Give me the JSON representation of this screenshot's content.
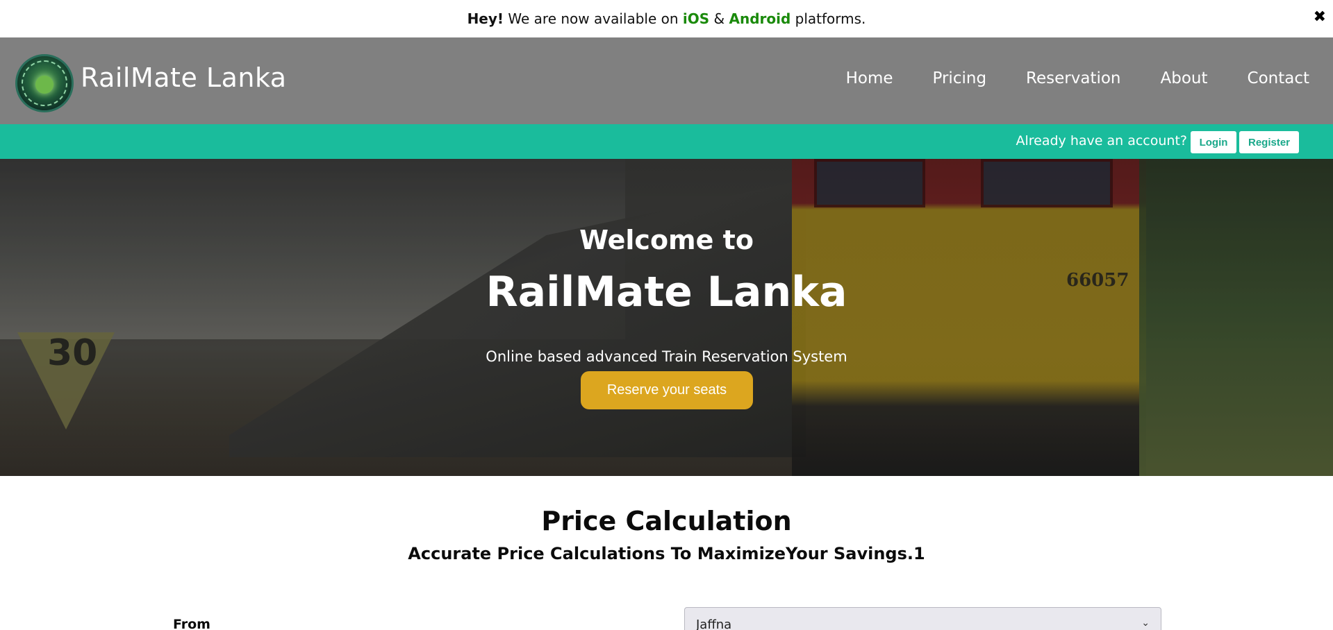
{
  "announcement": {
    "hey": "Hey!",
    "text_before": "We are now available on",
    "ios": "iOS",
    "amp": "&",
    "android": "Android",
    "text_after": "platforms.",
    "close_icon": "✖"
  },
  "header": {
    "brand": "RailMate Lanka",
    "logo_icon": "railmate-logo",
    "nav": [
      "Home",
      "Pricing",
      "Reservation",
      "About",
      "Contact"
    ]
  },
  "account_bar": {
    "prompt": "Already have an account?",
    "login_label": "Login",
    "register_label": "Register"
  },
  "hero": {
    "welcome": "Welcome to",
    "title": "RailMate Lanka",
    "tagline": "Online based advanced Train Reservation System",
    "cta_label": "Reserve your seats",
    "photo_number": "66057",
    "sign_number": "30"
  },
  "price_calc": {
    "title": "Price Calculation",
    "subtitle": "Accurate Price Calculations To MaximizeYour Savings.1",
    "from_label": "From",
    "from_value": "Jaffna"
  },
  "colors": {
    "accent": "#1abc9c",
    "cta": "#dca61f",
    "header_bg": "#808080",
    "highlight_green": "#1a8a0b"
  }
}
